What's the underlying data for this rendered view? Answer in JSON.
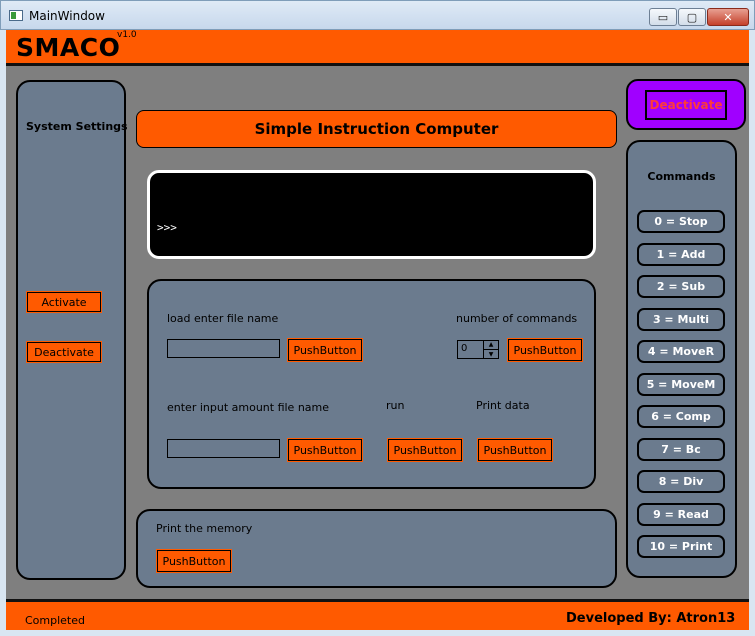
{
  "window": {
    "title": "MainWindow",
    "minimize": "▭",
    "maximize": "▢",
    "close": "✕"
  },
  "header": {
    "app_name": "SMACO",
    "version": "v1.0"
  },
  "system_settings": {
    "title": "System Settings",
    "activate_label": "Activate",
    "deactivate_label": "Deactivate"
  },
  "main": {
    "title": "Simple Instruction Computer",
    "console_prompt": ">>>",
    "load_label": "load enter file name",
    "load_value": "",
    "load_button": "PushButton",
    "ncmd_label": "number of commands",
    "ncmd_value": "0",
    "ncmd_button": "PushButton",
    "input_label": "enter input amount file name",
    "input_value": "",
    "input_button": "PushButton",
    "run_label": "run",
    "run_button": "PushButton",
    "print_label": "Print data",
    "print_button": "PushButton",
    "memory_label": "Print the memory",
    "memory_button": "PushButton"
  },
  "deactivate_main": {
    "label": "Deactivate"
  },
  "commands": {
    "title": "Commands",
    "items": [
      "0 = Stop",
      "1 = Add",
      "2 = Sub",
      "3 = Multi",
      "4 = MoveR",
      "5 = MoveM",
      "6 = Comp",
      "7 = Bc",
      "8 = Div",
      "9 = Read",
      "10 = Print"
    ]
  },
  "footer": {
    "status": "Completed",
    "credits": "Developed By: Atron13"
  },
  "colors": {
    "accent": "#ff5a00",
    "panel": "#6b7b8e",
    "background": "#7f7f7f",
    "deactivate_bg": "#a000ff",
    "deactivate_text": "#ff3a3a"
  }
}
